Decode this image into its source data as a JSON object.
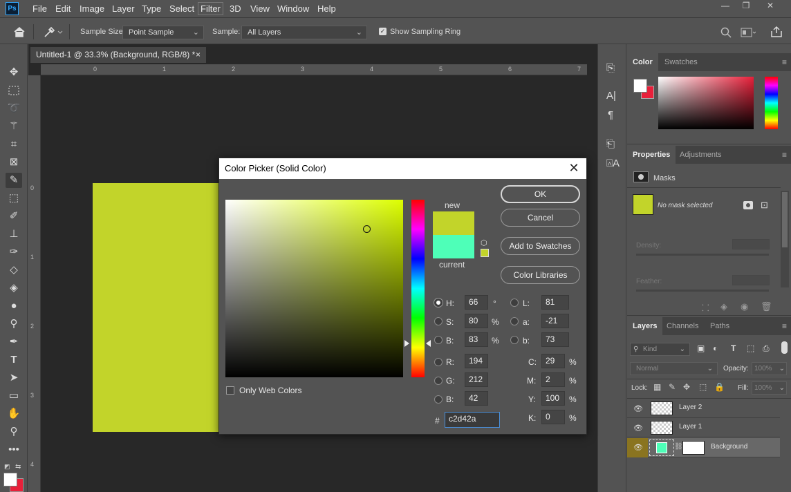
{
  "menu": {
    "logo": "Ps",
    "items": [
      "File",
      "Edit",
      "Image",
      "Layer",
      "Type",
      "Select",
      "Filter",
      "3D",
      "View",
      "Window",
      "Help"
    ],
    "active": "Filter"
  },
  "window_controls": {
    "minimize": "—",
    "restore": "❐",
    "close": "✕"
  },
  "options": {
    "sample_size_label": "Sample Size:",
    "sample_size_value": "Point Sample",
    "sample_label": "Sample:",
    "sample_value": "All Layers",
    "show_ring_label": "Show Sampling Ring",
    "show_ring_checked": true
  },
  "document": {
    "tab_title": "Untitled-1 @ 33.3% (Background, RGB/8) *",
    "tab_close": "×",
    "ruler_h": [
      "0",
      "1",
      "2",
      "3",
      "4",
      "5",
      "6",
      "7"
    ],
    "ruler_v": [
      "0",
      "1",
      "2",
      "3",
      "4"
    ],
    "canvas_color": "#c2d42a"
  },
  "dialog": {
    "title": "Color Picker (Solid Color)",
    "close": "✕",
    "new_label": "new",
    "current_label": "current",
    "new_color": "#c2d42a",
    "current_color": "#4effb8",
    "buttons": {
      "ok": "OK",
      "cancel": "Cancel",
      "add_swatches": "Add to Swatches",
      "libraries": "Color Libraries"
    },
    "only_web_colors": "Only Web Colors",
    "hsb": {
      "h_label": "H:",
      "h": "66",
      "h_unit": "°",
      "s_label": "S:",
      "s": "80",
      "s_unit": "%",
      "b_label": "B:",
      "b": "83",
      "b_unit": "%"
    },
    "rgb": {
      "r_label": "R:",
      "r": "194",
      "g_label": "G:",
      "g": "212",
      "b_label": "B:",
      "b": "42"
    },
    "lab": {
      "l_label": "L:",
      "l": "81",
      "a_label": "a:",
      "a": "-21",
      "b_label": "b:",
      "b": "73"
    },
    "cmyk": {
      "c_label": "C:",
      "c": "29",
      "m_label": "M:",
      "m": "2",
      "y_label": "Y:",
      "y": "100",
      "k_label": "K:",
      "k": "0",
      "unit": "%"
    },
    "hex_label": "#",
    "hex": "c2d42a",
    "selected_radio": "H"
  },
  "color_panel": {
    "tabs": [
      "Color",
      "Swatches"
    ],
    "fg": "#ffffff",
    "bg": "#e8203a"
  },
  "properties_panel": {
    "tabs": [
      "Properties",
      "Adjustments"
    ],
    "section": "Masks",
    "mask_text": "No mask selected",
    "density_label": "Density:",
    "feather_label": "Feather:"
  },
  "layers_panel": {
    "tabs": [
      "Layers",
      "Channels",
      "Paths"
    ],
    "kind_label": "Kind",
    "blend_mode": "Normal",
    "opacity_label": "Opacity:",
    "opacity": "100%",
    "lock_label": "Lock:",
    "fill_label": "Fill:",
    "fill": "100%",
    "layers": [
      {
        "name": "Layer 2",
        "selected": false
      },
      {
        "name": "Layer 1",
        "selected": false
      },
      {
        "name": "Background",
        "selected": true
      }
    ]
  }
}
